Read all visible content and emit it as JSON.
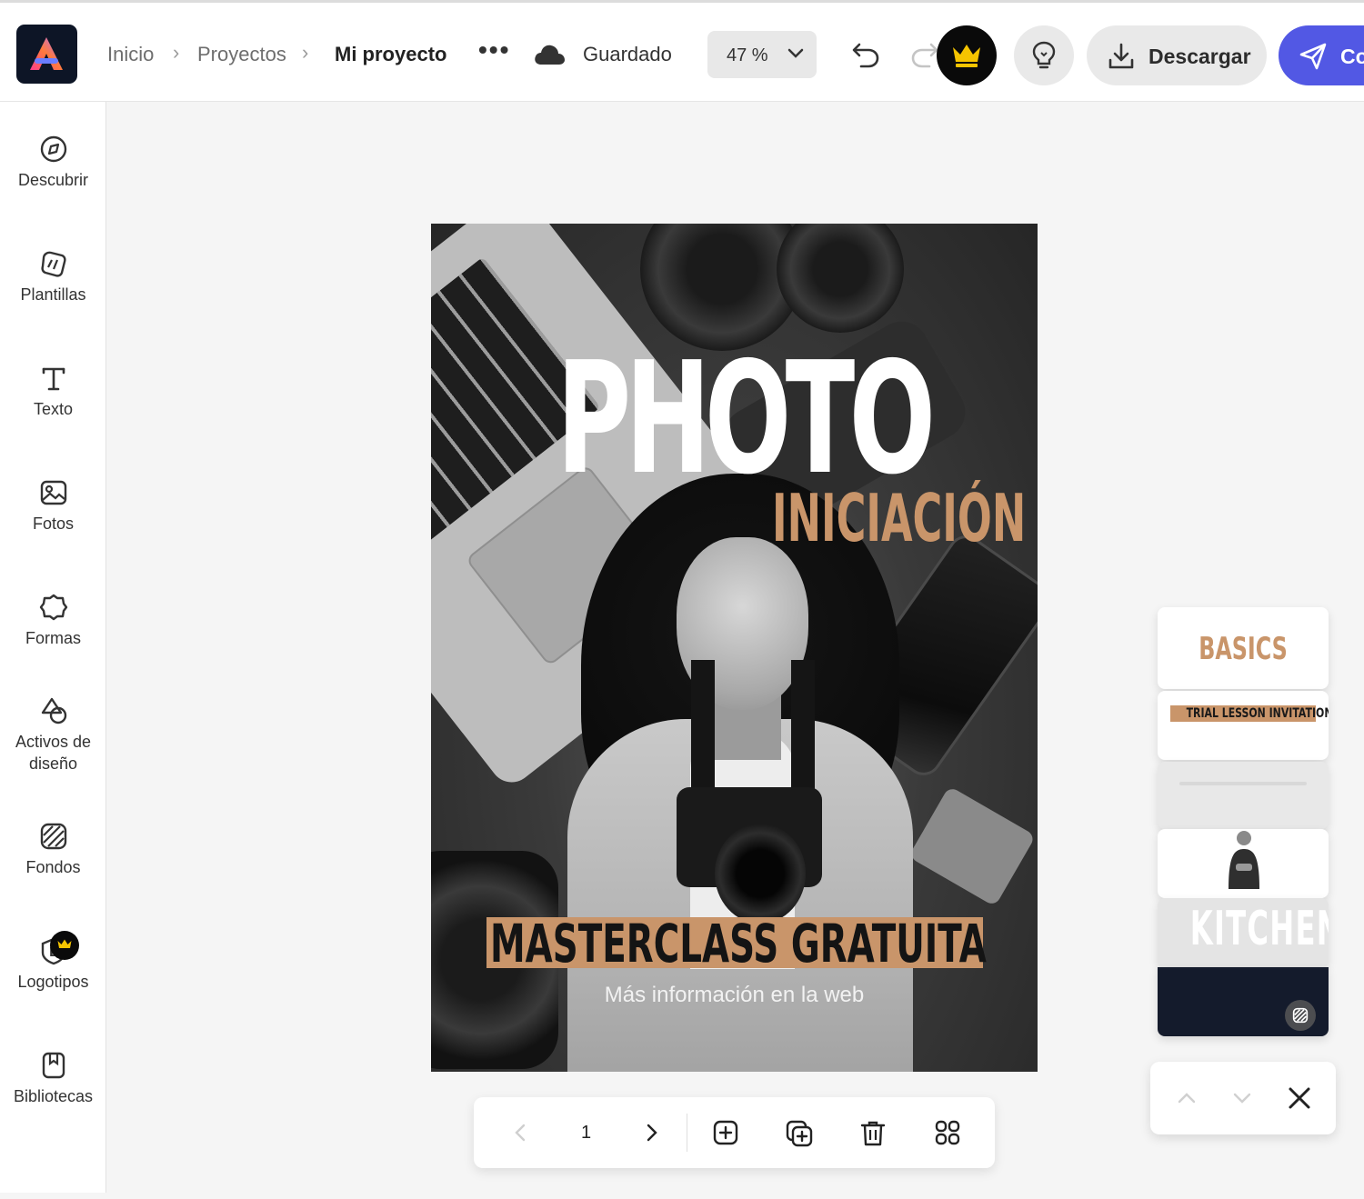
{
  "header": {
    "breadcrumb": [
      "Inicio",
      "Proyectos"
    ],
    "current_project": "Mi proyecto",
    "more_label": "•••",
    "save_status": "Guardado",
    "zoom": "47 %",
    "download_label": "Descargar",
    "share_label": "Co"
  },
  "sidebar": {
    "items": [
      {
        "label": "Descubrir",
        "icon": "compass-icon"
      },
      {
        "label": "Plantillas",
        "icon": "templates-icon"
      },
      {
        "label": "Texto",
        "icon": "text-icon"
      },
      {
        "label": "Fotos",
        "icon": "photo-icon"
      },
      {
        "label": "Formas",
        "icon": "shapes-icon"
      },
      {
        "label": "Activos de diseño",
        "icon": "design-assets-icon"
      },
      {
        "label": "Fondos",
        "icon": "backgrounds-icon"
      },
      {
        "label": "Logotipos",
        "icon": "logo-icon",
        "premium": true
      },
      {
        "label": "Bibliotecas",
        "icon": "library-icon"
      }
    ]
  },
  "poster": {
    "title": "PHOTO",
    "subtitle": "INICIACIÓN",
    "banner": "MASTERCLASS GRATUITA",
    "info": "Más información en la web",
    "accent_color": "#c9956a"
  },
  "page_stack": {
    "cards": [
      {
        "text": "BASICS"
      },
      {
        "text": "TRIAL LESSON INVITATION"
      },
      {
        "text": ""
      },
      {
        "text": ""
      },
      {
        "text": "KITCHEN"
      },
      {
        "text": ""
      }
    ]
  },
  "pagebar": {
    "page_number": "1"
  },
  "colors": {
    "brand_blue": "#5258e4",
    "accent": "#c9956a"
  }
}
